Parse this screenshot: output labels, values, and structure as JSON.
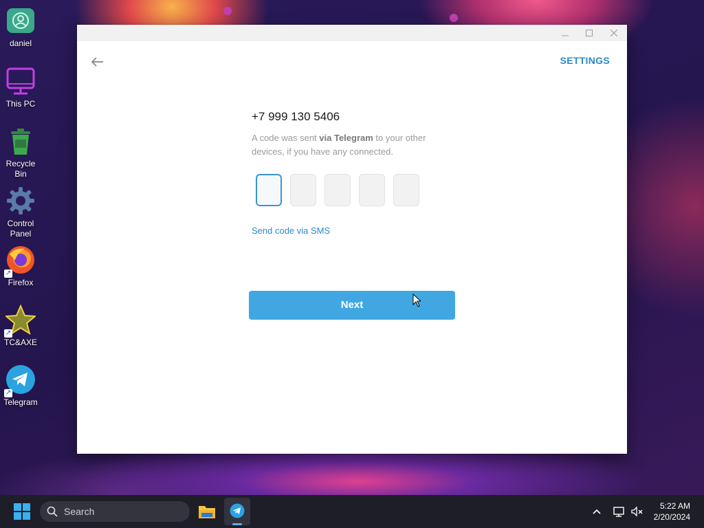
{
  "desktop": {
    "icons": [
      {
        "label": "daniel",
        "icon": "user-folder-icon"
      },
      {
        "label": "This PC",
        "icon": "monitor-icon"
      },
      {
        "label": "Recycle Bin",
        "icon": "recycle-bin-icon"
      },
      {
        "label": "Control Panel",
        "icon": "gear-icon"
      },
      {
        "label": "Firefox",
        "icon": "firefox-icon"
      },
      {
        "label": "TC&AXE",
        "icon": "star-icon"
      },
      {
        "label": "Telegram",
        "icon": "telegram-icon"
      }
    ]
  },
  "window": {
    "settings_label": "SETTINGS",
    "phone": "+7 999 130 5406",
    "desc_pre": "A code was sent ",
    "desc_bold": "via Telegram",
    "desc_post": " to your other devices, if you have any connected.",
    "code_digits": [
      "",
      "",
      "",
      "",
      ""
    ],
    "sms_link": "Send code via SMS",
    "next_label": "Next"
  },
  "taskbar": {
    "search_placeholder": "Search",
    "time": "5:22 AM",
    "date": "2/20/2024"
  },
  "colors": {
    "accent": "#40a7e3",
    "link": "#2a8ac8"
  }
}
